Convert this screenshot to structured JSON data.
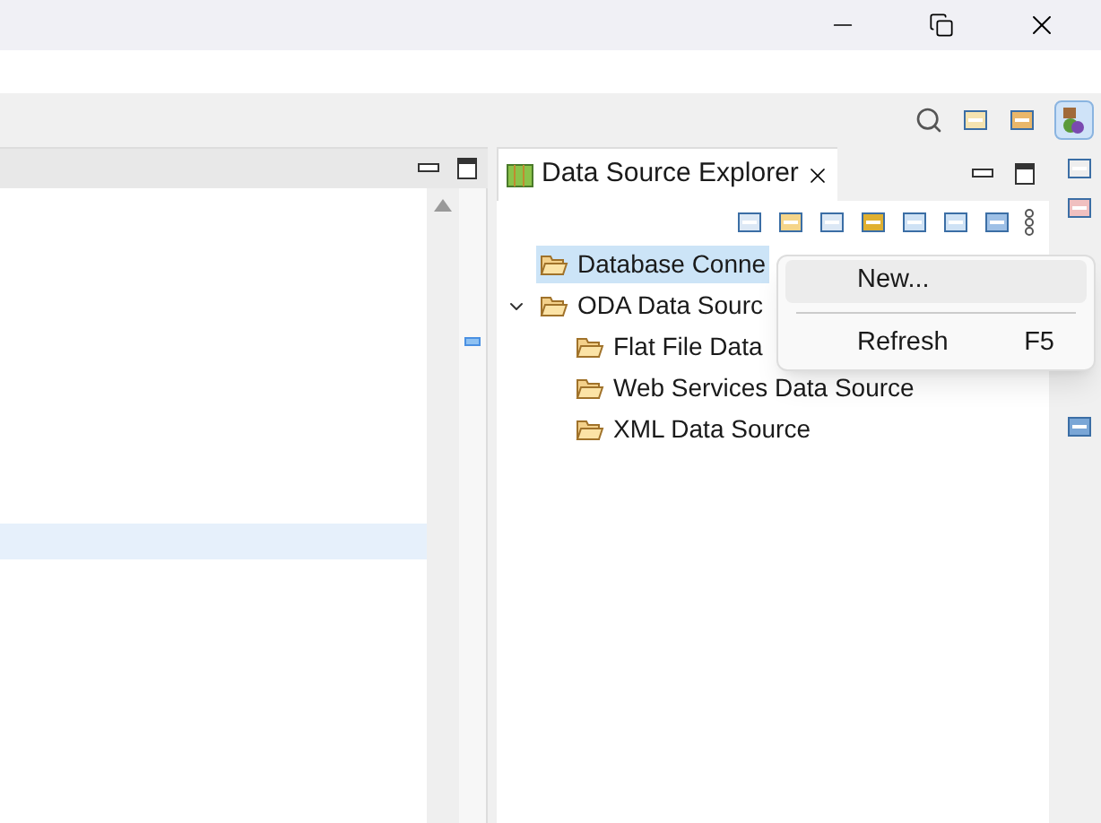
{
  "view": {
    "title": "Data Source Explorer"
  },
  "tree": [
    {
      "label": "Database Conne",
      "selected": true
    },
    {
      "label": "ODA Data Sourc",
      "selected": false,
      "children": [
        {
          "label": "Flat File Data",
          "selected": false
        },
        {
          "label": "Web Services Data Source",
          "selected": false
        },
        {
          "label": "XML Data Source",
          "selected": false
        }
      ]
    }
  ],
  "context_menu": [
    {
      "kind": "item",
      "label": "New...",
      "selected": true
    },
    {
      "kind": "separator"
    },
    {
      "kind": "item",
      "label": "Refresh",
      "shortcut": "F5",
      "selected": false
    }
  ]
}
